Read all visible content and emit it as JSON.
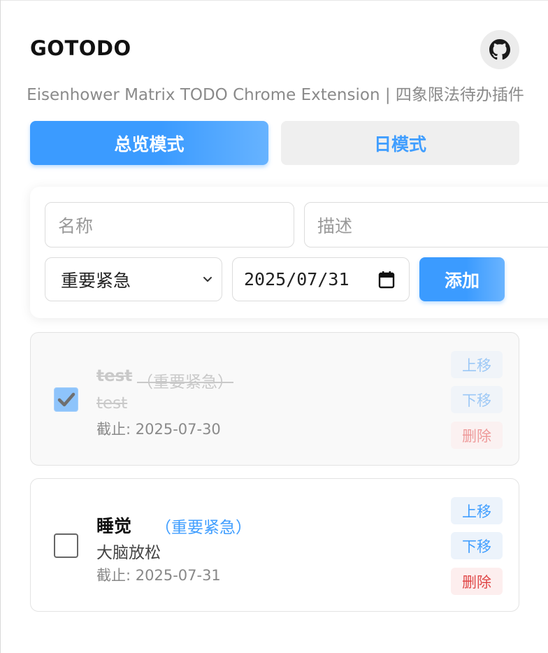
{
  "header": {
    "title": "GOTODO",
    "subtitle": "Eisenhower Matrix TODO Chrome Extension | 四象限法待办插件",
    "github_icon": "github-icon"
  },
  "modes": {
    "overview": "总览模式",
    "day": "日模式",
    "active": "overview"
  },
  "form": {
    "name_placeholder": "名称",
    "desc_placeholder": "描述",
    "priority_selected": "重要紧急",
    "date_value": "2025/07/31",
    "add_label": "添加"
  },
  "todos": [
    {
      "name": "test",
      "priority": "（重要紧急）",
      "description": "test",
      "deadline": "截止: 2025-07-30",
      "completed": true,
      "up_label": "上移",
      "down_label": "下移",
      "delete_label": "删除"
    },
    {
      "name": "睡觉",
      "priority": "（重要紧急）",
      "description": "大脑放松",
      "deadline": "截止: 2025-07-31",
      "completed": false,
      "up_label": "上移",
      "down_label": "下移",
      "delete_label": "删除"
    }
  ],
  "colors": {
    "accent": "#409eff",
    "danger": "#e04848"
  }
}
